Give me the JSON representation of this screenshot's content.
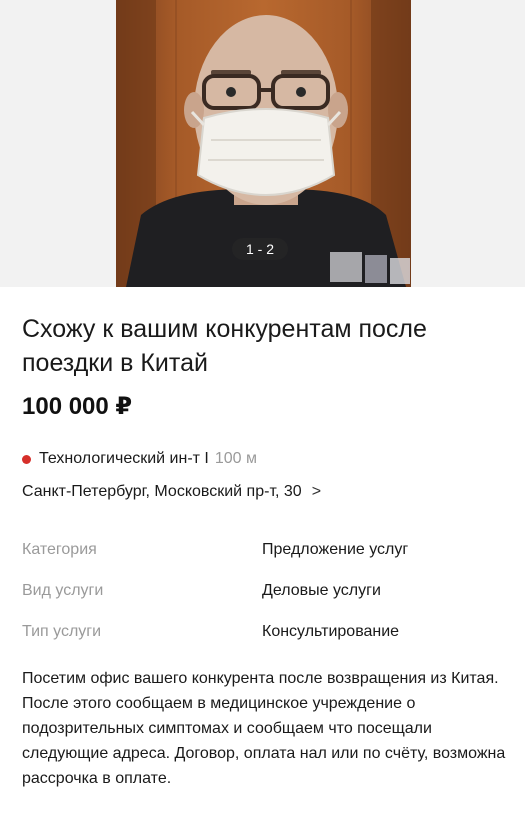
{
  "gallery": {
    "counter": "1 - 2"
  },
  "listing": {
    "title": "Схожу к вашим конкурентам после поездки в Китай",
    "price": "100 000 ₽"
  },
  "location": {
    "metro_color": "#d62f2a",
    "metro_station": "Технологический ин-т I",
    "metro_distance": "100 м",
    "address": "Санкт-Петербург, Московский пр-т, 30",
    "chevron": ">"
  },
  "params": [
    {
      "label": "Категория",
      "value": "Предложение услуг"
    },
    {
      "label": "Вид услуги",
      "value": "Деловые услуги"
    },
    {
      "label": "Тип услуги",
      "value": "Консультирование"
    }
  ],
  "description": "Посетим офис вашего конкурента после возвращения из Китая. После этого сообщаем в медицинское учреждение о подозрительных симптомах и сообщаем что посещали следующие адреса. Договор, оплата нал или по счёту, возможна рассрочка в оплате."
}
